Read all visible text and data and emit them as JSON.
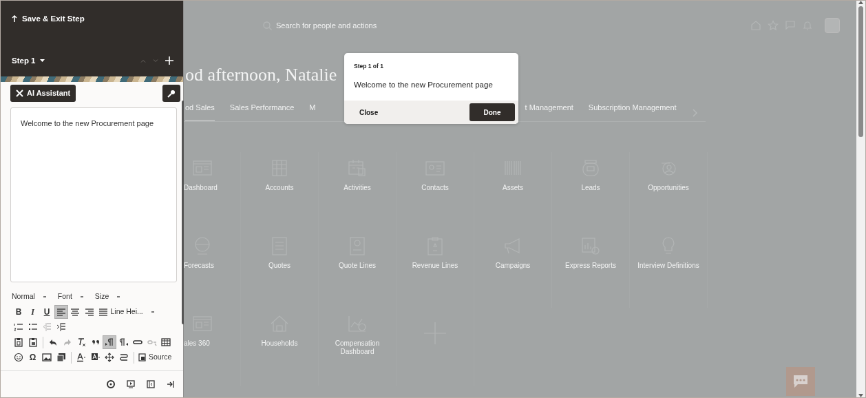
{
  "editor_panel": {
    "save_exit": "Save & Exit Step",
    "step_label": "Step 1",
    "step_nav": [
      {
        "kind": "up",
        "disabled": true
      },
      {
        "kind": "down",
        "disabled": true
      },
      {
        "kind": "add",
        "disabled": false
      }
    ],
    "ai_button": "AI Assistant",
    "content": "Welcome to the new Procurement page",
    "toolbar": [
      [
        {
          "kind": "dropdown",
          "label": "Normal"
        },
        {
          "kind": "dropdown",
          "label": "Font"
        },
        {
          "kind": "dropdown",
          "label": "Size"
        }
      ],
      [
        {
          "kind": "bold",
          "text": "B",
          "selected": false,
          "disabled": false
        },
        {
          "kind": "italic",
          "text": "I",
          "selected": false,
          "disabled": false
        },
        {
          "kind": "underline",
          "text": "U",
          "selected": false,
          "disabled": false
        },
        {
          "kind": "icon",
          "selected": true,
          "disabled": false
        },
        {
          "kind": "icon",
          "selected": false,
          "disabled": false
        },
        {
          "kind": "icon",
          "selected": false,
          "disabled": false
        },
        {
          "kind": "icon",
          "selected": false,
          "disabled": false
        },
        {
          "kind": "dropdown",
          "label": "Line Hei..."
        }
      ],
      [
        {
          "kind": "icon",
          "selected": false,
          "disabled": false
        },
        {
          "kind": "icon",
          "selected": false,
          "disabled": false
        },
        {
          "kind": "icon",
          "selected": false,
          "disabled": true
        },
        {
          "kind": "icon",
          "selected": false,
          "disabled": false
        }
      ],
      [
        {
          "kind": "icon",
          "selected": false,
          "disabled": false
        },
        {
          "kind": "icon",
          "selected": false,
          "disabled": false
        },
        {
          "kind": "separator"
        },
        {
          "kind": "icon",
          "selected": false,
          "disabled": false
        },
        {
          "kind": "icon",
          "selected": false,
          "disabled": true
        },
        {
          "kind": "icon",
          "selected": false,
          "disabled": false
        },
        {
          "kind": "icon",
          "selected": false,
          "disabled": false
        },
        {
          "kind": "icon",
          "selected": true,
          "disabled": false
        },
        {
          "kind": "icon",
          "selected": false,
          "disabled": false
        },
        {
          "kind": "icon",
          "selected": false,
          "disabled": false
        },
        {
          "kind": "icon",
          "selected": false,
          "disabled": true
        },
        {
          "kind": "icon",
          "selected": false,
          "disabled": false
        }
      ],
      [
        {
          "kind": "icon",
          "selected": false,
          "disabled": false
        },
        {
          "kind": "glyph",
          "text": "Ω",
          "selected": false,
          "disabled": false
        },
        {
          "kind": "icon",
          "selected": false,
          "disabled": false
        },
        {
          "kind": "icon",
          "selected": false,
          "disabled": false
        },
        {
          "kind": "separator"
        },
        {
          "kind": "icon",
          "selected": false,
          "disabled": false
        },
        {
          "kind": "icon",
          "selected": false,
          "disabled": false
        },
        {
          "kind": "icon",
          "selected": false,
          "disabled": false
        },
        {
          "kind": "icon",
          "selected": false,
          "disabled": false
        },
        {
          "kind": "separator"
        },
        {
          "kind": "source",
          "label": "Source"
        }
      ]
    ]
  },
  "page": {
    "search_placeholder": "Search for people and actions",
    "greeting": "od afternoon, Natalie",
    "tabs": [
      {
        "label": "od Sales",
        "selected": true
      },
      {
        "label": "Sales Performance",
        "selected": false
      },
      {
        "label": "M",
        "selected": false
      },
      {
        "label": "t Management",
        "selected": false
      },
      {
        "label": "Subscription Management",
        "selected": false
      }
    ],
    "tiles": [
      [
        {
          "kind": "tile",
          "label": "Dashboard"
        },
        {
          "kind": "tile",
          "label": "Accounts"
        },
        {
          "kind": "tile",
          "label": "Activities"
        },
        {
          "kind": "tile",
          "label": "Contacts"
        },
        {
          "kind": "tile",
          "label": "Assets"
        },
        {
          "kind": "tile",
          "label": "Leads"
        },
        {
          "kind": "tile",
          "label": "Opportunities"
        }
      ],
      [
        {
          "kind": "tile",
          "label": "Forecasts"
        },
        {
          "kind": "tile",
          "label": "Quotes"
        },
        {
          "kind": "tile",
          "label": "Quote Lines"
        },
        {
          "kind": "tile",
          "label": "Revenue Lines"
        },
        {
          "kind": "tile",
          "label": "Campaigns"
        },
        {
          "kind": "tile",
          "label": "Express Reports"
        },
        {
          "kind": "tile",
          "label": "Interview Definitions"
        }
      ],
      [
        {
          "kind": "tile",
          "label": "ales 360"
        },
        {
          "kind": "tile",
          "label": "Households"
        },
        {
          "kind": "tile",
          "label": "Compensation Dashboard"
        },
        {
          "kind": "add"
        }
      ]
    ]
  },
  "dialog": {
    "step": "Step 1 of 1",
    "message": "Welcome to the new Procurement page",
    "close": "Close",
    "done": "Done"
  }
}
